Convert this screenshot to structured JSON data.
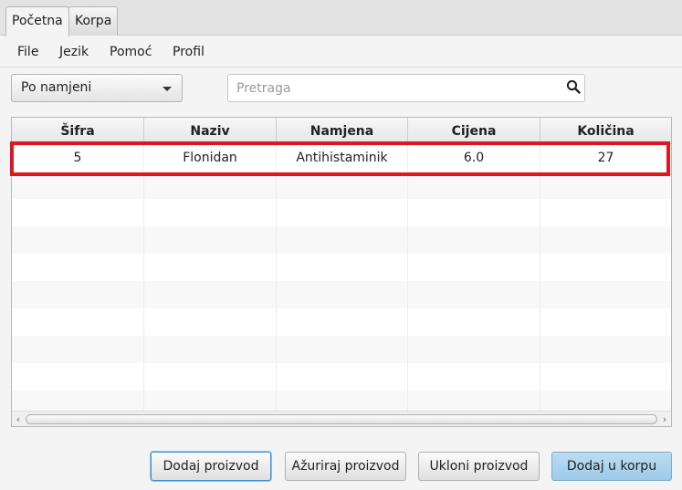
{
  "tabs": [
    {
      "label": "Početna",
      "active": true
    },
    {
      "label": "Korpa",
      "active": false
    }
  ],
  "menu": [
    "File",
    "Jezik",
    "Pomoć",
    "Profil"
  ],
  "filter": {
    "selected": "Po namjeni"
  },
  "search": {
    "placeholder": "Pretraga",
    "value": ""
  },
  "table": {
    "columns": [
      "Šifra",
      "Naziv",
      "Namjena",
      "Cijena",
      "Količina"
    ],
    "rows": [
      [
        "5",
        "Flonidan",
        "Antihistaminik",
        "6.0",
        "27"
      ]
    ],
    "highlighted_row": 0,
    "highlight_color": "#e0161f"
  },
  "buttons": {
    "add_product": "Dodaj proizvod",
    "update_product": "Ažuriraj proizvod",
    "remove_product": "Ukloni proizvod",
    "add_to_cart": "Dodaj u korpu"
  },
  "icons": {
    "search": "search-icon",
    "dropdown": "chevron-down-icon"
  }
}
